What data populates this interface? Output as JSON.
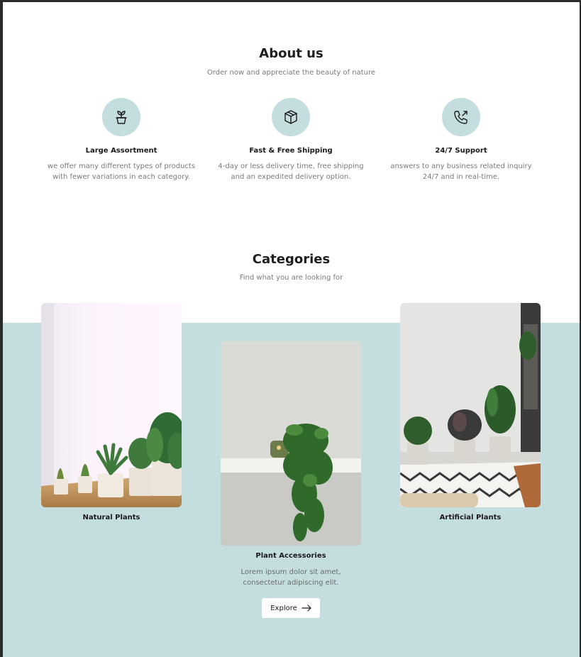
{
  "about": {
    "title": "About us",
    "subtitle": "Order now and appreciate the beauty of nature",
    "features": [
      {
        "icon": "plant-pot-icon",
        "title": "Large Assortment",
        "desc_line1": "we offer many different types of products",
        "desc_line2": "with fewer variations in each category."
      },
      {
        "icon": "box-icon",
        "title": "Fast & Free Shipping",
        "desc_line1": "4-day or less delivery time, free shipping",
        "desc_line2": "and an expedited delivery option."
      },
      {
        "icon": "phone-call-icon",
        "title": "24/7 Support",
        "desc_line1": "answers to any business related inquiry",
        "desc_line2": "24/7 and in real-time."
      }
    ]
  },
  "categories": {
    "title": "Categories",
    "subtitle": "Find what you are looking for",
    "cards": [
      {
        "label": "Natural Plants"
      },
      {
        "label": "Plant Accessories",
        "desc_line1": "Lorem ipsum dolor sit amet,",
        "desc_line2": "consectetur adipiscing elit.",
        "button_label": "Explore"
      },
      {
        "label": "Artificial Plants"
      }
    ]
  },
  "colors": {
    "accent": "#c4dedf",
    "text": "#1a1a1a",
    "muted": "#7a7a7a"
  }
}
